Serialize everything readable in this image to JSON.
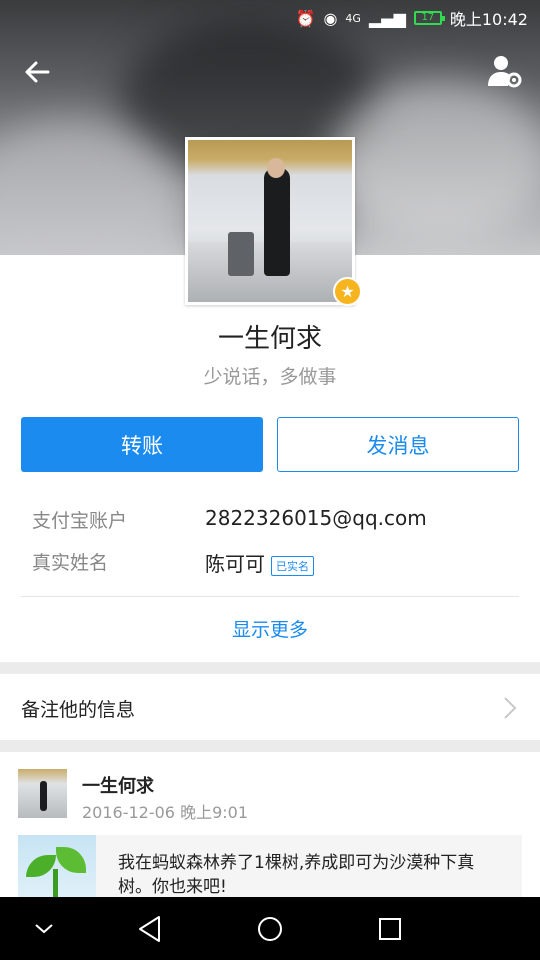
{
  "status_bar": {
    "network": "4G",
    "battery": "17",
    "time": "晚上10:42"
  },
  "profile": {
    "name": "一生何求",
    "motto": "少说话，多做事"
  },
  "actions": {
    "transfer_label": "转账",
    "message_label": "发消息"
  },
  "info": {
    "account_label": "支付宝账户",
    "account_value": "2822326015@qq.com",
    "realname_label": "真实姓名",
    "realname_value": "陈可可",
    "verified_badge": "已实名"
  },
  "show_more_label": "显示更多",
  "note": {
    "label": "备注他的信息"
  },
  "feed": {
    "name": "一生何求",
    "time": "2016-12-06 晚上9:01",
    "text": "我在蚂蚁森林养了1棵树,养成即可为沙漠种下真树。你也来吧!"
  },
  "colors": {
    "accent": "#1b8bef",
    "badge_star": "#f6b51e",
    "battery": "#2fdc4f"
  },
  "icons": {
    "back": "arrow-left-icon",
    "settings": "user-settings-icon",
    "star": "star-badge-icon",
    "chevron": "chevron-right-icon",
    "nav_down": "chevron-down-icon",
    "nav_back": "triangle-back-icon",
    "nav_home": "circle-home-icon",
    "nav_recent": "square-recent-icon"
  }
}
